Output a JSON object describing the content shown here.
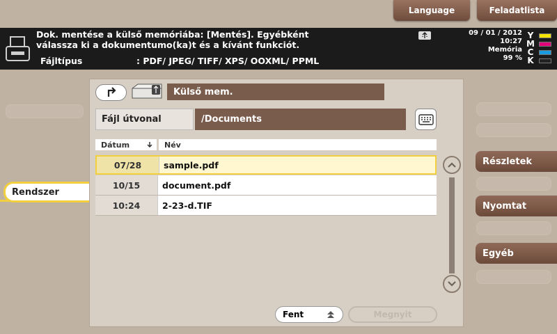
{
  "top": {
    "language_label": "Language",
    "jobs_label": "Feladatlista"
  },
  "message": {
    "line1": "Dok. mentése a külső memóriába: [Mentés]. Egyébként",
    "line2": "válassza ki a dokumentumo(ka)t és a kívánt funkciót.",
    "filetype_label": "Fájltípus",
    "filetype_value": ": PDF/ JPEG/ TIFF/ XPS/ OOXML/ PPML"
  },
  "status": {
    "date": "09 / 01 / 2012",
    "time": "10:27",
    "memory_label": "Memória",
    "memory_value": "99 %"
  },
  "toner": [
    {
      "letter": "Y",
      "color": "#f5e400"
    },
    {
      "letter": "M",
      "color": "#e0007a"
    },
    {
      "letter": "C",
      "color": "#1a9be0"
    },
    {
      "letter": "K",
      "color": "#222222"
    }
  ],
  "location": {
    "label": "Külső mem."
  },
  "path": {
    "label": "Fájl útvonal",
    "value": "/Documents"
  },
  "table": {
    "headers": {
      "date": "Dátum",
      "name": "Név"
    },
    "rows": [
      {
        "date": "07/28",
        "name": "sample.pdf",
        "selected": true
      },
      {
        "date": "10/15",
        "name": "document.pdf",
        "selected": false
      },
      {
        "date": "10:24",
        "name": "2-23-d.TIF",
        "selected": false
      }
    ]
  },
  "buttons": {
    "top_label": "Fent",
    "open_label": "Megnyit"
  },
  "left": {
    "system_label": "Rendszer"
  },
  "right": {
    "details_label": "Részletek",
    "print_label": "Nyomtat",
    "other_label": "Egyéb"
  }
}
